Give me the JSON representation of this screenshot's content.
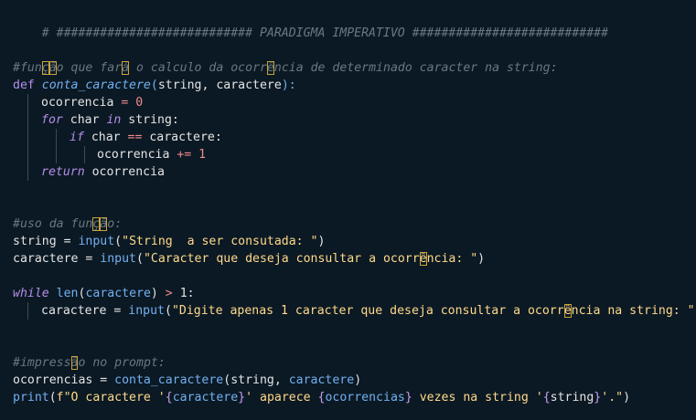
{
  "code": {
    "l1": "# ########################### PARADIGMA IMPERATIVO ###########################",
    "l4a": "#fun",
    "l4b": "ç",
    "l4c": "ã",
    "l4d": "o que far",
    "l4e": "á",
    "l4f": " o calculo da ocorr",
    "l4g": "ê",
    "l4h": "ncia de determinado caracter na string:",
    "def": "def",
    "fname": "conta_caractere",
    "sig_open": "(",
    "p1": "string",
    "comma": ", ",
    "p2": "caractere",
    "sig_close": "):",
    "l6a": "ocorrencia",
    "l6b": " = ",
    "l6c": "0",
    "for": "for",
    "l7a": " char ",
    "in": "in",
    "l7b": " string:",
    "if": "if",
    "l8a": " char ",
    "l8b": "==",
    "l8c": " caractere:",
    "l9a": "ocorrencia ",
    "l9b": "+=",
    "l9c": " 1",
    "return": "return",
    "l10a": " ocorrencia",
    "l13a": "#uso da fun",
    "l13b": "ç",
    "l13c": "ã",
    "l13d": "o:",
    "l14a": "string = ",
    "input": "input",
    "l14b": "(",
    "l14c": "\"String  a ser consutada: \"",
    "l14d": ")",
    "l15a": "caractere = ",
    "l15b": "(",
    "l15c1": "\"Caracter que deseja consultar a ocorr",
    "l15c2": "ê",
    "l15c3": "ncia: \"",
    "l15d": ")",
    "while": "while",
    "len": "len",
    "l17a": "(",
    "l17b": "caractere",
    "l17c": ") ",
    "l17d": ">",
    "l17e": " 1:",
    "l18a": "caractere = ",
    "l18b": "(",
    "l18c1": "\"Digite apenas 1 caracter que deseja consultar a ocorr",
    "l18c2": "ê",
    "l18c3": "ncia na string: \"",
    "l18d": ")",
    "l21a": "#impress",
    "l21b": "ã",
    "l21c": "o no prompt:",
    "l22a": "ocorrencias = ",
    "l22b": "conta_caractere",
    "l22c": "(",
    "l22d": "string",
    "l22e": ", ",
    "l22f": "caractere",
    "l22g": ")",
    "print": "print",
    "l23a": "(",
    "l23b": "f\"O caractere '",
    "l23c": "{",
    "l23d": "caractere",
    "l23e": "}",
    "l23f": "' aparece ",
    "l23g": "{",
    "l23h": "ocorrencias",
    "l23i": "}",
    "l23j": " vezes na string '",
    "l23k": "{",
    "l23l": "string",
    "l23m": "}",
    "l23n": "'.\"",
    "l23o": ")"
  },
  "colors": {
    "background": "#0b1924",
    "comment": "#6b7780",
    "keyword": "#b48ee8",
    "function": "#73b0f0",
    "number": "#f08a8a",
    "string": "#ffd98a"
  }
}
